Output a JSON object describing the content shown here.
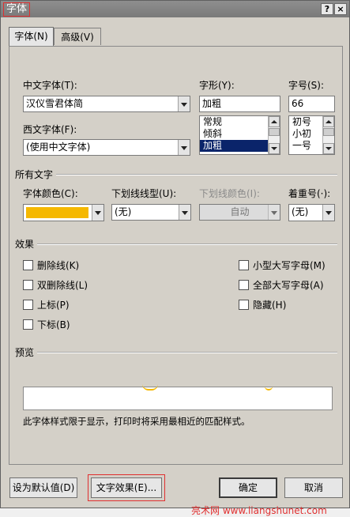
{
  "window": {
    "title": "字体",
    "help": "?",
    "close": "×"
  },
  "tabs": [
    {
      "label": "字体(N)"
    },
    {
      "label": "高级(V)"
    }
  ],
  "font": {
    "chinese_label": "中文字体(T):",
    "chinese_value": "汉仪雪君体简",
    "western_label": "西文字体(F):",
    "western_value": "(使用中文字体)",
    "style_label": "字形(Y):",
    "style_value": "加粗",
    "style_options": [
      "常规",
      "倾斜",
      "加粗"
    ],
    "style_selected": "加粗",
    "size_label": "字号(S):",
    "size_value": "66",
    "size_options": [
      "初号",
      "小初",
      "一号"
    ]
  },
  "all_text": {
    "group_label": "所有文字",
    "color_label": "字体颜色(C):",
    "color_value": "#f5b800",
    "underline_style_label": "下划线线型(U):",
    "underline_style_value": "(无)",
    "underline_color_label": "下划线颜色(I):",
    "underline_color_value": "自动",
    "emphasis_label": "着重号(·):",
    "emphasis_value": "(无)"
  },
  "effects": {
    "group_label": "效果",
    "items": [
      {
        "label": "删除线(K)"
      },
      {
        "label": "双删除线(L)"
      },
      {
        "label": "上标(P)"
      },
      {
        "label": "下标(B)"
      },
      {
        "label": "小型大写字母(M)"
      },
      {
        "label": "全部大写字母(A)"
      },
      {
        "label": "隐藏(H)"
      }
    ]
  },
  "preview": {
    "group_label": "预览",
    "note": "此字体样式限于显示，打印时将采用最相近的匹配样式。"
  },
  "watermark": "亮术网 www.liangshunet.com",
  "buttons": {
    "set_default": "设为默认值(D)",
    "text_effects": "文字效果(E)...",
    "ok": "确定",
    "cancel": "取消"
  }
}
